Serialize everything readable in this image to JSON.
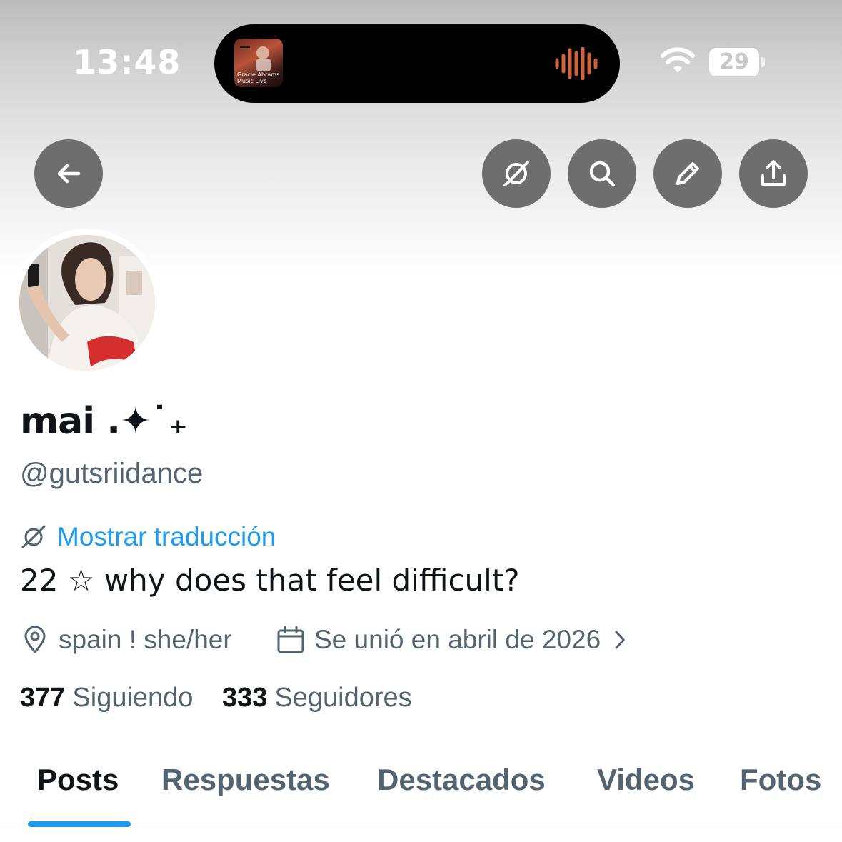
{
  "status_bar": {
    "time": "13:48",
    "battery": "29",
    "now_playing": {
      "line1": "Gracie Abrams",
      "line2": "Music Live"
    }
  },
  "nav": {
    "back_icon": "arrow-left-icon",
    "actions": [
      "translate-icon",
      "search-icon",
      "pencil-icon",
      "share-icon"
    ]
  },
  "profile": {
    "display_name": "mai .✦˙₊",
    "handle": "@gutsriidance",
    "translate_label": "Mostrar traducción",
    "bio": "22 ☆ why does that feel difficult?",
    "location": "spain ! she/her",
    "joined": "Se unió en abril de 2026",
    "following_count": "377",
    "following_label": "Siguiendo",
    "followers_count": "333",
    "followers_label": "Seguidores"
  },
  "tabs": [
    {
      "label": "Posts",
      "active": true
    },
    {
      "label": "Respuestas",
      "active": false
    },
    {
      "label": "Destacados",
      "active": false
    },
    {
      "label": "Videos",
      "active": false
    },
    {
      "label": "Fotos",
      "active": false
    }
  ],
  "colors": {
    "accent": "#1d9bf0",
    "secondary_text": "#536471",
    "button_bg": "#6e6e6e"
  }
}
